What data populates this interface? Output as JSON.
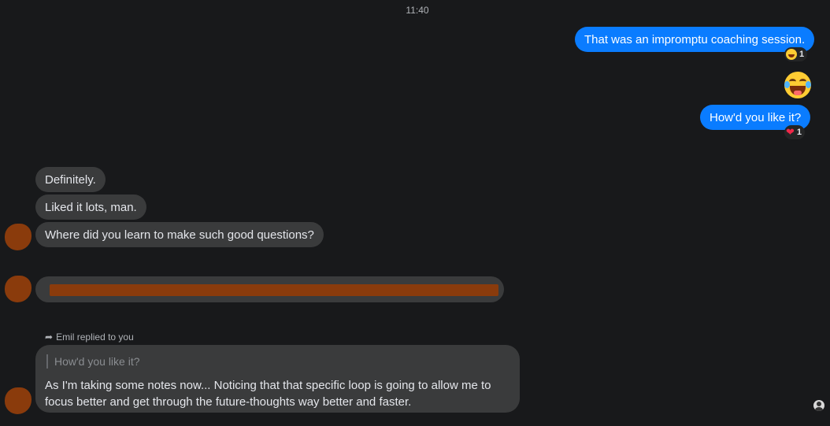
{
  "timestamp": "11:40",
  "messages": {
    "out1": {
      "text": "That was an impromptu coaching session.",
      "reaction_count": "1",
      "reaction_icon": "grinning-face-icon"
    },
    "out_emoji": {
      "icon": "face-with-tears-of-joy-icon"
    },
    "out2": {
      "text": "How'd you like it?",
      "reaction_count": "1",
      "reaction_icon": "red-heart-icon"
    },
    "in1": {
      "text": "Definitely."
    },
    "in2": {
      "text": "Liked it lots, man."
    },
    "in3": {
      "text": "Where did you learn to make such good questions?"
    },
    "in4": {
      "text": ""
    },
    "reply": {
      "label": "Emil replied to you",
      "quoted": "How'd you like it?",
      "text": "As I'm taking some notes now... Noticing that that specific loop is going to allow me to focus better and get through the future-thoughts way better and faster."
    }
  },
  "colors": {
    "background": "#18191b",
    "outgoing_bubble": "#0a7cff",
    "incoming_bubble": "#3a3b3c",
    "redaction": "#8a3b0c"
  }
}
